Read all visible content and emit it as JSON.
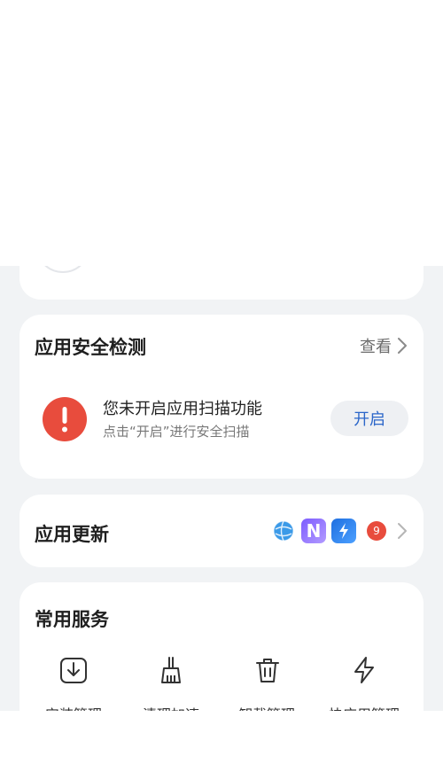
{
  "security": {
    "title": "应用安全检测",
    "view_label": "查看",
    "alert_title": "您未开启应用扫描功能",
    "alert_desc": "点击“开启”进行安全扫描",
    "enable_label": "开启"
  },
  "update": {
    "title": "应用更新",
    "badge_count": "9",
    "icons": [
      "globe-app-icon",
      "n-app-icon",
      "bolt-app-icon"
    ]
  },
  "services": {
    "title": "常用服务",
    "items": [
      {
        "label": "安装管理",
        "icon": "install-icon"
      },
      {
        "label": "清理加速",
        "icon": "broom-icon"
      },
      {
        "label": "卸载管理",
        "icon": "trash-icon"
      },
      {
        "label": "快应用管理",
        "icon": "quick-app-icon"
      }
    ]
  },
  "colors": {
    "accent": "#2b66c9",
    "alert": "#e84c3d",
    "background": "#f1f3f5"
  }
}
